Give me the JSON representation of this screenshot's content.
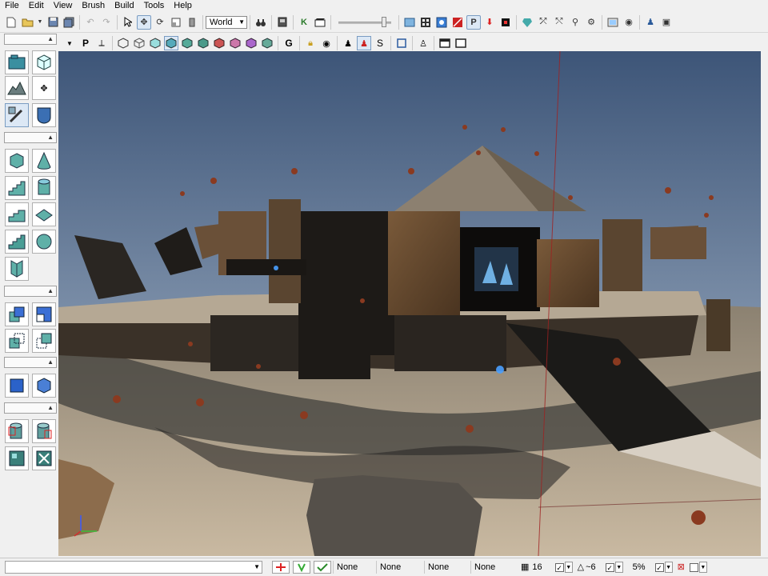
{
  "menu": [
    "File",
    "Edit",
    "View",
    "Brush",
    "Build",
    "Tools",
    "Help"
  ],
  "toolbar": {
    "coordinate_system": "World",
    "slider_fraction": 0.9,
    "left_icons": [
      "new-file-icon",
      "open-folder-icon",
      "dropdown-icon",
      "save-icon",
      "save-all-icon",
      "undo-icon",
      "redo-icon",
      "select-cursor-icon",
      "translate-icon",
      "rotate-icon",
      "scale-icon",
      "scale-nonuniform-icon"
    ],
    "mid_icons": [
      "binoculars-icon",
      "matinee-icon",
      "kismet-icon",
      "clapper-icon"
    ],
    "right_icons": [
      "content-browser-icon",
      "generic-browser-icon",
      "actor-classes-icon",
      "play-in-editor-icon",
      "play-on-pc-icon",
      "build-geometry-icon",
      "build-lighting-icon",
      "build-paths-icon",
      "build-cover-icon",
      "build-all-icon",
      "lightmass-icon",
      "material-editor-icon",
      "console-icon",
      "user-icon",
      "level-icon"
    ],
    "play_label": "P",
    "kismet_label": "K"
  },
  "viewport_toolbar": {
    "perspective_label": "P",
    "group_label": "G",
    "realtime_label": "S",
    "view_modes": [
      "wireframe-icon",
      "brush-wireframe-icon",
      "unlit-icon",
      "lit-icon",
      "detail-lighting-icon",
      "lighting-only-icon",
      "light-complexity-icon",
      "texture-density-icon",
      "shader-complexity-icon",
      "lightmap-density-icon"
    ]
  },
  "sidebar": {
    "groups": [
      {
        "tools": [
          "camera-mode-icon",
          "geometry-mode-icon",
          "terrain-mode-icon",
          "transform-widget-icon",
          "texture-align-icon",
          "mesh-paint-icon"
        ]
      },
      {
        "tools": [
          "cube-brush-icon",
          "cone-brush-icon",
          "linear-stair-icon",
          "cylinder-brush-icon",
          "curved-stair-icon",
          "sheet-brush-icon",
          "spiral-stair-icon",
          "sphere-brush-icon",
          "volumetric-brush-icon"
        ]
      },
      {
        "tools": [
          "csg-add-icon",
          "csg-subtract-icon",
          "csg-intersect-icon",
          "csg-deintersect-icon"
        ]
      },
      {
        "tools": [
          "add-volume-icon",
          "add-special-icon"
        ]
      },
      {
        "tools": [
          "hide-selected-icon",
          "show-selected-icon",
          "select-all-icon",
          "invert-selection-icon"
        ]
      }
    ]
  },
  "statusbar": {
    "fields": [
      "None",
      "None",
      "None",
      "None"
    ],
    "grid_value": "16",
    "rotation_value": "~6",
    "scale_value": "5%"
  },
  "colors": {
    "chrome": "#f0f0f0",
    "sky_top": "#3d5578",
    "sky_bottom": "#aabbcc",
    "ground": "#c9b9a1"
  }
}
